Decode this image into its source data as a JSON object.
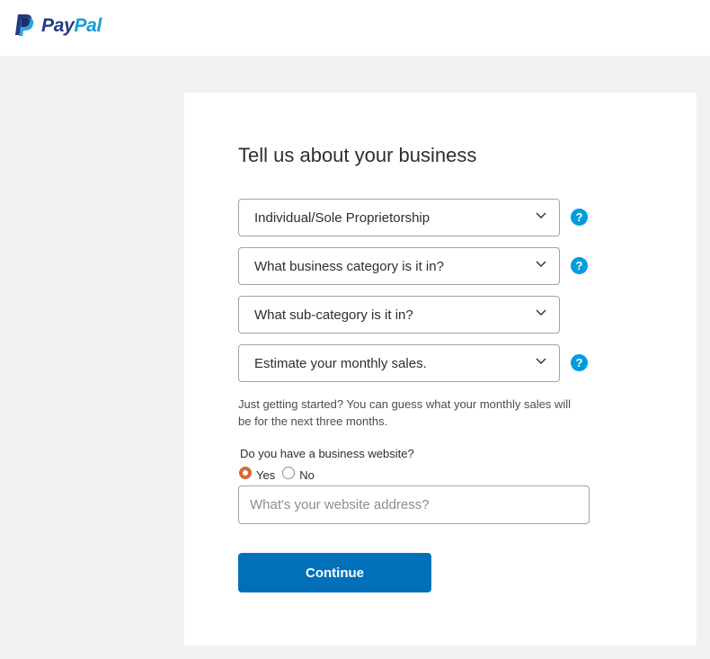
{
  "header": {
    "logo_word_pay": "Pay",
    "logo_word_pal": "Pal"
  },
  "form": {
    "title": "Tell us about your business",
    "business_type": {
      "selected": "Individual/Sole Proprietorship",
      "help": "?"
    },
    "business_category": {
      "placeholder": "What business category is it in?",
      "help": "?"
    },
    "sub_category": {
      "placeholder": "What sub-category is it in?"
    },
    "monthly_sales": {
      "placeholder": "Estimate your monthly sales.",
      "help": "?"
    },
    "sales_hint": "Just getting started? You can guess what your monthly sales will be for the next three months.",
    "website_question": "Do you have a business website?",
    "website_options": {
      "yes": "Yes",
      "no": "No",
      "selected": "Yes"
    },
    "website_input": {
      "placeholder": "What's your website address?",
      "value": ""
    },
    "continue_label": "Continue"
  },
  "colors": {
    "accent": "#0070ba",
    "help_icon": "#009cde",
    "radio_selected": "#d36a3a",
    "logo_dark": "#253b80",
    "logo_light": "#179bd7"
  }
}
